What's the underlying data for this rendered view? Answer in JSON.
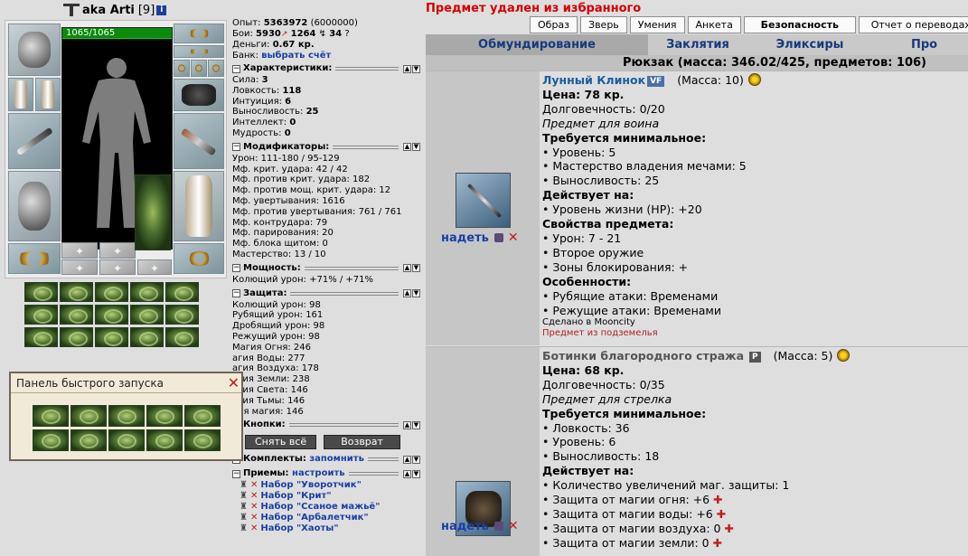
{
  "character": {
    "nick": "aka Arti",
    "level": "[9]",
    "info_icon": "i",
    "hp": "1065/1065"
  },
  "stats_top": {
    "exp_label": "Опыт:",
    "exp_value": "5363972",
    "exp_next": "(6000000)",
    "fights_label": "Бои:",
    "fights_won": "5930",
    "fights_lost": "1264",
    "fights_draw": "34",
    "money_label": "Деньги:",
    "money_value": "0.67 кр.",
    "bank_label": "Банк:",
    "bank_link": "выбрать счёт"
  },
  "sections": {
    "characteristics": "Характеристики:",
    "modifiers": "Модификаторы:",
    "powers": "Мощность:",
    "protection": "Защита:",
    "buttons": "Кнопки:",
    "sets": "Комплекты:",
    "sets_link": "запомнить",
    "tricks": "Приемы:",
    "tricks_link": "настроить"
  },
  "characteristics": [
    {
      "label": "Сила:",
      "value": "3"
    },
    {
      "label": "Ловкость:",
      "value": "118"
    },
    {
      "label": "Интуиция:",
      "value": "6"
    },
    {
      "label": "Выносливость:",
      "value": "25"
    },
    {
      "label": "Интеллект:",
      "value": "0"
    },
    {
      "label": "Мудрость:",
      "value": "0"
    }
  ],
  "modifiers": [
    "Урон: 111-180 / 95-129",
    "Мф. крит. удара: 42 / 42",
    "Мф. против крит. удара: 182",
    "Мф. против мощ. крит. удара: 12",
    "Мф. увертывания: 1616",
    "Мф. против увертывания: 761 / 761",
    "Мф. контрудара: 79",
    "Мф. парирования: 20",
    "Мф. блока щитом: 0",
    "Мастерство: 13 / 10"
  ],
  "powers": [
    "Колющий урон: +71% / +71%"
  ],
  "protection": [
    "Колющий урон: 98",
    "Рубящий урон: 161",
    "Дробящий урон: 98",
    "Режущий урон: 98",
    "Магия Огня: 246",
    "агия Воды: 277",
    "агия Воздуха: 178",
    "агия Земли: 238",
    "агия Света: 146",
    "агия Тьмы: 146",
    "рая магия: 146"
  ],
  "buttons": {
    "undress": "Снять всё",
    "return": "Возврат"
  },
  "tricks": [
    "Набор \"Уворотчик\"",
    "Набор \"Крит\"",
    "Набор \"Ссаное мажьё\"",
    "Набор \"Арбалетчик\"",
    "Набор \"Хаоты\""
  ],
  "quick_panel": {
    "title": "Панель быстрого запуска",
    "close": "✕"
  },
  "message": "Предмет удален из избранного",
  "top_buttons": [
    "Образ",
    "Зверь",
    "Умения",
    "Анкета",
    "Безопасность",
    "Отчет о переводах"
  ],
  "tabs": [
    "Обмундирование",
    "Заклятия",
    "Эликсиры",
    "Про"
  ],
  "backpack": "Рюкзак (масса: 346.02/425, предметов: 106)",
  "items": [
    {
      "name": "Лунный Клинок",
      "badge": "VF",
      "mass": "(Масса: 10)",
      "price": "Цена: 78 кр.",
      "durability": "Долговечность: 0/20",
      "purpose": "Предмет для воина",
      "req_title": "Требуется минимальное:",
      "requirements": [
        "• Уровень: 5",
        "• Мастерство владения мечами: 5",
        "• Выносливость: 25"
      ],
      "acts_title": "Действует на:",
      "acts": [
        "• Уровень жизни (HP): +20"
      ],
      "props_title": "Свойства предмета:",
      "props": [
        "• Урон: 7 - 21",
        "• Второе оружие",
        "• Зоны блокирования: +"
      ],
      "features_title": "Особенности:",
      "features": [
        "• Рубящие атаки: Временами",
        "• Режущие атаки: Временами"
      ],
      "made": "Сделано в Mooncity",
      "origin": "Предмет из подземелья",
      "wear": "надеть",
      "del": "✕"
    },
    {
      "name": "Ботинки благородного стража",
      "badge": "P",
      "mass": "(Масса: 5)",
      "price": "Цена: 68 кр.",
      "durability": "Долговечность: 0/35",
      "purpose": "Предмет для стрелка",
      "req_title": "Требуется минимальное:",
      "requirements": [
        "• Ловкость: 36",
        "• Уровень: 6",
        "• Выносливость: 18"
      ],
      "acts_title": "Действует на:",
      "acts": [
        "• Количество увеличений маг. защиты: 1",
        "• Защита от магии огня: +6",
        "• Защита от магии воды: +6",
        "• Защита от магии воздуха: 0",
        "• Защита от магии земли: 0"
      ],
      "wear": "надеть",
      "del": "✕"
    }
  ],
  "icons": {
    "plus": "✚",
    "close": "✕"
  }
}
